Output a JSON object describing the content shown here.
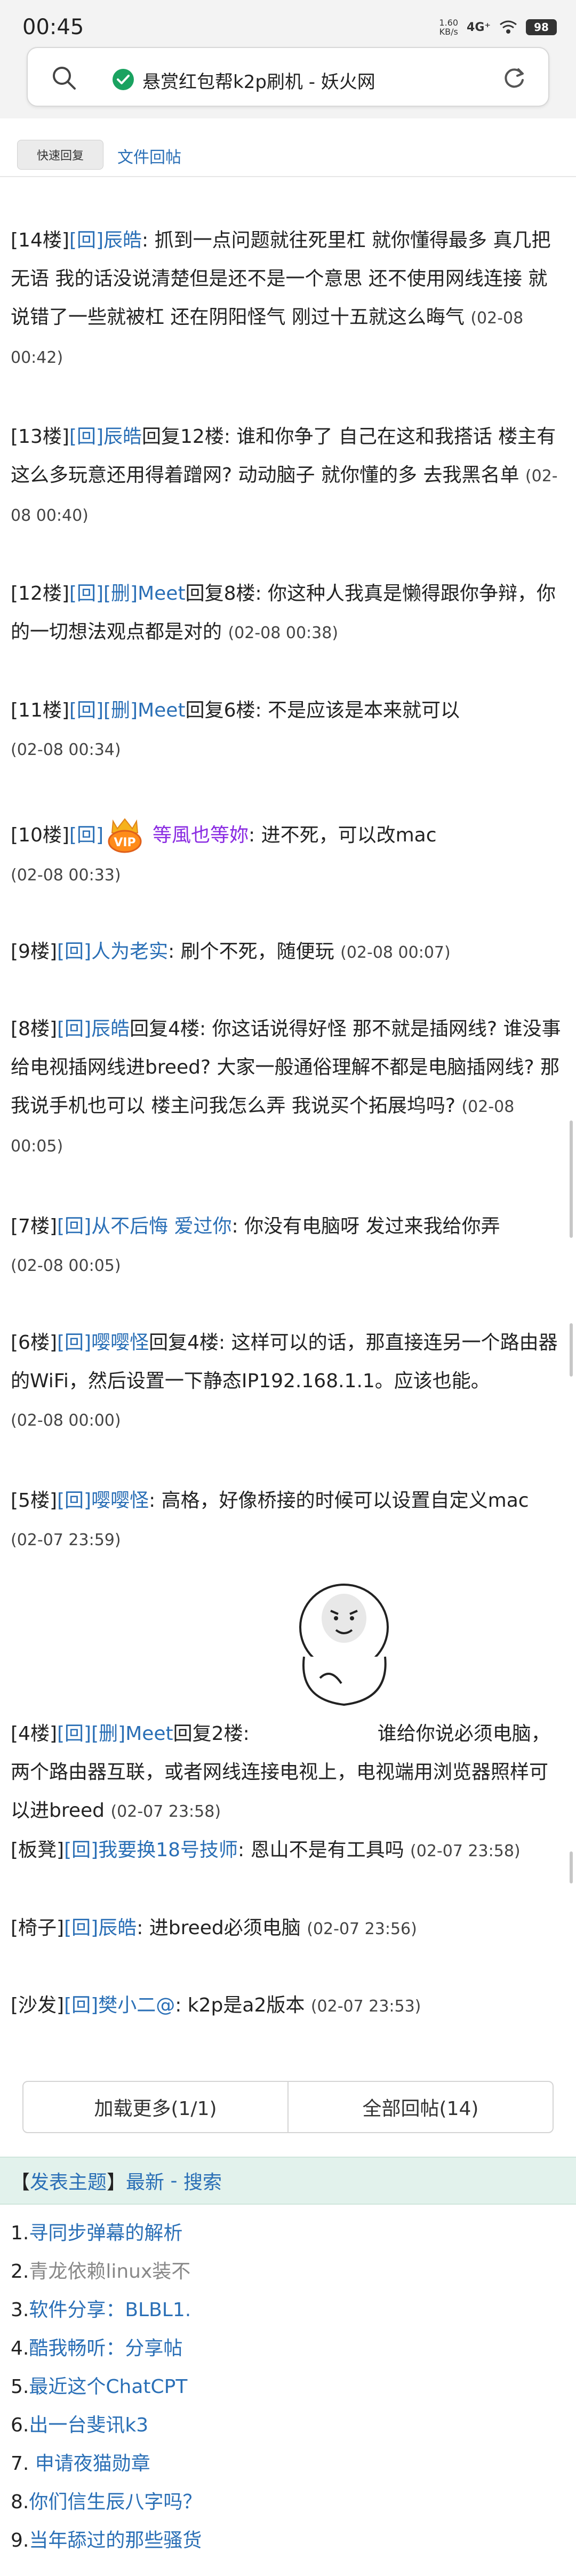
{
  "status_bar": {
    "time": "00:45",
    "net_speed": "1.60",
    "net_unit": "KB/s",
    "signal": "4G⁺",
    "battery": "98"
  },
  "address_bar": {
    "title": "悬赏红包帮k2p刷机 - 妖火网"
  },
  "top_actions": {
    "quick_reply": "快速回复",
    "text_reply": "文件回帖"
  },
  "posts": [
    {
      "floor": "[14楼]",
      "reply": "[回]",
      "user": "辰皓",
      "sep": ":",
      "text": " 抓到一点问题就往死里杠 就你懂得最多 真几把无语 我的话没说清楚但是还不是一个意思 还不使用网线连接 就说错了一些就被杠 还在阴阳怪气 刚过十五就这么晦气",
      "time": "(02-08 00:42)"
    },
    {
      "floor": "[13楼]",
      "reply": "[回]",
      "user": "辰皓",
      "text": "回复12楼: 谁和你争了 自己在这和我搭话 楼主有这么多玩意还用得着蹭网? 动动脑子 就你懂的多 去我黑名单",
      "time": "(02-08 00:40)"
    },
    {
      "floor": "[12楼]",
      "reply": "[回]",
      "del": "[删]",
      "user": "Meet",
      "text": "回复8楼: 你这种人我真是懒得跟你争辩，你的一切想法观点都是对的",
      "time": "(02-08 00:38)"
    },
    {
      "floor": "[11楼]",
      "reply": "[回]",
      "del": "[删]",
      "user": "Meet",
      "text": "回复6楼: 不是应该是本来就可以",
      "time": "(02-08 00:34)"
    },
    {
      "floor": "[10楼]",
      "reply": "[回]",
      "user": "等風也等妳",
      "text": ": 进不死，可以改mac",
      "time": "(02-08 00:33)"
    },
    {
      "floor": "[9楼]",
      "reply": "[回]",
      "user": "人为老实",
      "text": ": 刷个不死，随便玩",
      "time": "(02-08 00:07)"
    },
    {
      "floor": "[8楼]",
      "reply": "[回]",
      "user": "辰皓",
      "text": "回复4楼: 你这话说得好怪 那不就是插网线? 谁没事给电视插网线进breed? 大家一般通俗理解不都是电脑插网线? 那我说手机也可以 楼主问我怎么弄 我说买个拓展坞吗?",
      "time": "(02-08 00:05)"
    },
    {
      "floor": "[7楼]",
      "reply": "[回]",
      "user": "从不后悔 爱过你",
      "text": ": 你没有电脑呀 发过来我给你弄",
      "time": "(02-08 00:05)"
    },
    {
      "floor": "[6楼]",
      "reply": "[回]",
      "user": "嘤嘤怪",
      "text": "回复4楼: 这样可以的话，那直接连另一个路由器的WiFi，然后设置一下静态IP192.168.1.1。应该也能。",
      "time": "(02-08 00:00)"
    },
    {
      "floor": "[5楼]",
      "reply": "[回]",
      "user": "嘤嘤怪",
      "text": ": 高格，好像桥接的时候可以设置自定义mac",
      "time": "(02-07 23:59)"
    },
    {
      "floor": "[4楼]",
      "reply": "[回]",
      "del": "[删]",
      "user": "Meet",
      "text": "回复2楼:",
      "text2": "谁给你说必须电脑，两个路由器互联，或者网线连接电视上，电视端用浏览器照样可以进breed",
      "time": "(02-07 23:58)"
    },
    {
      "floor": "[板凳]",
      "reply": "[回]",
      "user": "我要换18号技师",
      "text": ": 恩山不是有工具吗",
      "time": "(02-07 23:58)"
    },
    {
      "floor": "[椅子]",
      "reply": "[回]",
      "user": "辰皓",
      "text": ": 进breed必须电脑",
      "time": "(02-07 23:56)"
    },
    {
      "floor": "[沙发]",
      "reply": "[回]",
      "user": "樊小二@",
      "text": ": k2p是a2版本",
      "time": "(02-07 23:53)"
    }
  ],
  "buttons": {
    "load_more": "加载更多(1/1)",
    "all_replies": "全部回帖(14)"
  },
  "footer": {
    "open": "【",
    "post_topic": "发表主题",
    "close": "】",
    "latest": "最新",
    "dash": " - ",
    "search": "搜索"
  },
  "topics": [
    {
      "num": "1.",
      "title": "寻同步弹幕的解析"
    },
    {
      "num": "2.",
      "title": "青龙依赖linux装不"
    },
    {
      "num": "3.",
      "title": "软件分享：BLBL1."
    },
    {
      "num": "4.",
      "title": "酷我畅听：分享帖"
    },
    {
      "num": "5.",
      "title": "最近这个ChatCPT"
    },
    {
      "num": "6.",
      "title": "出一台斐讯k3"
    },
    {
      "num": "7.",
      "title": " 申请夜猫勋章"
    },
    {
      "num": "8.",
      "title": "你们信生辰八字吗？"
    },
    {
      "num": "9.",
      "title": "当年舔过的那些骚货"
    }
  ],
  "colors": {
    "link": "#2a6fb6",
    "vip_name": "#8a2be2",
    "footer_bg": "#e2f2ec"
  }
}
